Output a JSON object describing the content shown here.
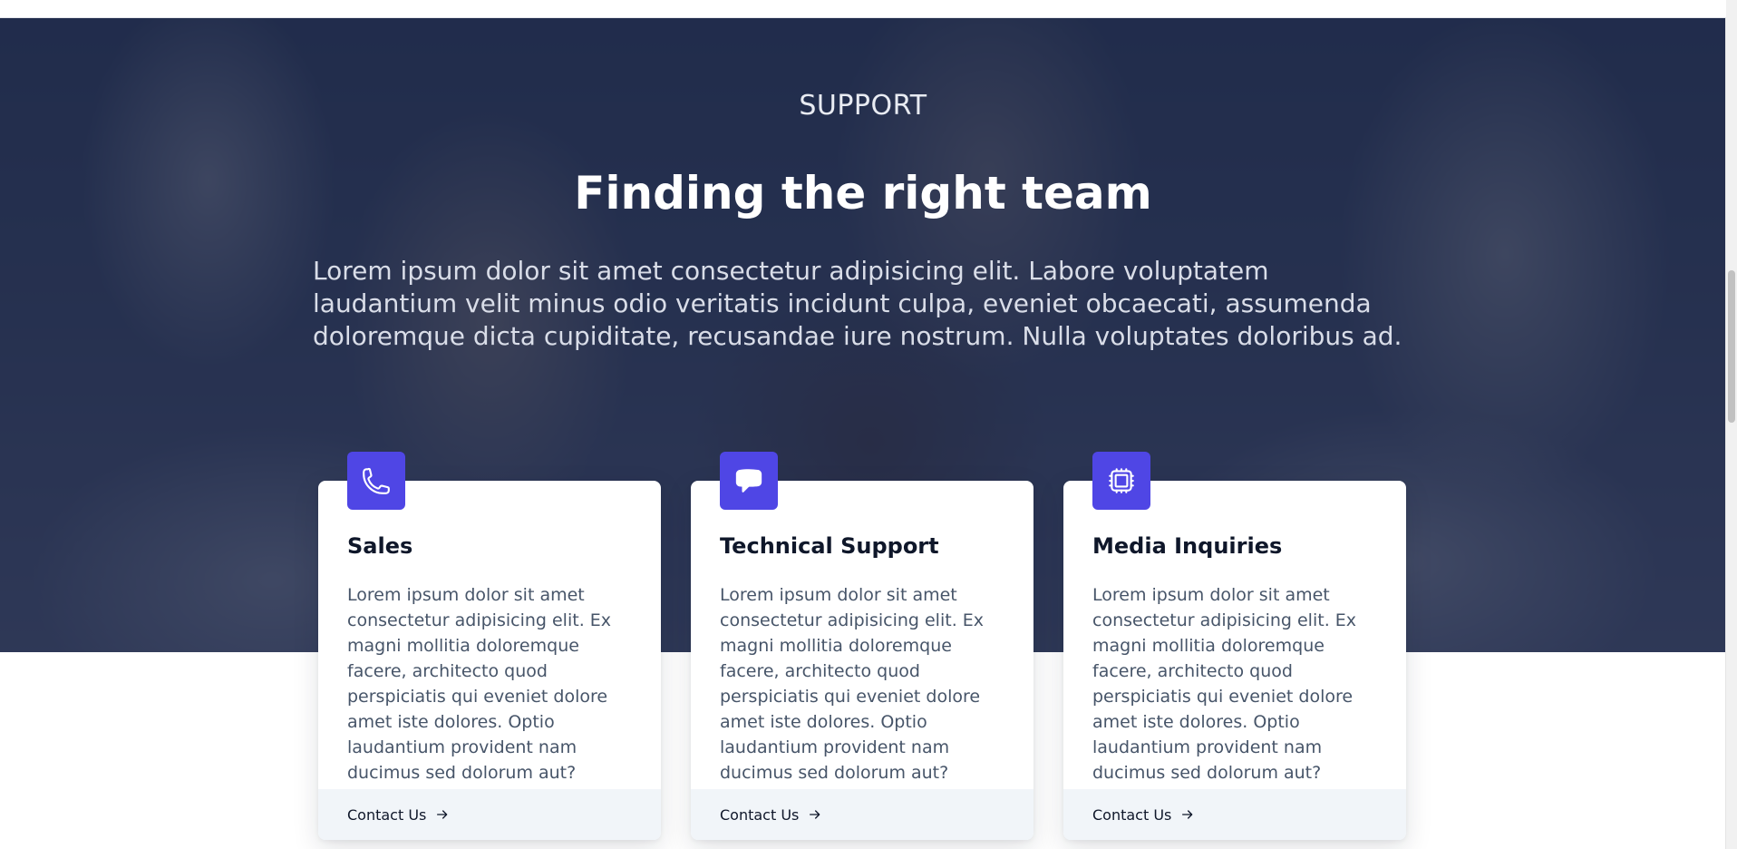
{
  "hero": {
    "eyebrow": "SUPPORT",
    "title": "Finding the right team",
    "lead": "Lorem ipsum dolor sit amet consectetur adipisicing elit. Labore voluptatem laudantium velit minus odio veritatis incidunt culpa, eveniet obcaecati, assumenda doloremque dicta cupiditate, recusandae iure nostrum. Nulla voluptates doloribus ad."
  },
  "cards": [
    {
      "icon": "phone-icon",
      "title": "Sales",
      "body": "Lorem ipsum dolor sit amet consectetur adipisicing elit. Ex magni mollitia doloremque facere, architecto quod perspiciatis qui eveniet dolore amet iste dolores. Optio laudantium provident nam ducimus sed dolorum aut?",
      "cta": "Contact Us"
    },
    {
      "icon": "chat-bubble-icon",
      "title": "Technical Support",
      "body": "Lorem ipsum dolor sit amet consectetur adipisicing elit. Ex magni mollitia doloremque facere, architecto quod perspiciatis qui eveniet dolore amet iste dolores. Optio laudantium provident nam ducimus sed dolorum aut?",
      "cta": "Contact Us"
    },
    {
      "icon": "cpu-chip-icon",
      "title": "Media Inquiries",
      "body": "Lorem ipsum dolor sit amet consectetur adipisicing elit. Ex magni mollitia doloremque facere, architecto quod perspiciatis qui eveniet dolore amet iste dolores. Optio laudantium provident nam ducimus sed dolorum aut?",
      "cta": "Contact Us"
    }
  ],
  "colors": {
    "accent": "#4f46e5",
    "overlay": "#172344",
    "card_footer": "#f1f5f9",
    "heading": "#0f172a",
    "body_text": "#475569"
  }
}
